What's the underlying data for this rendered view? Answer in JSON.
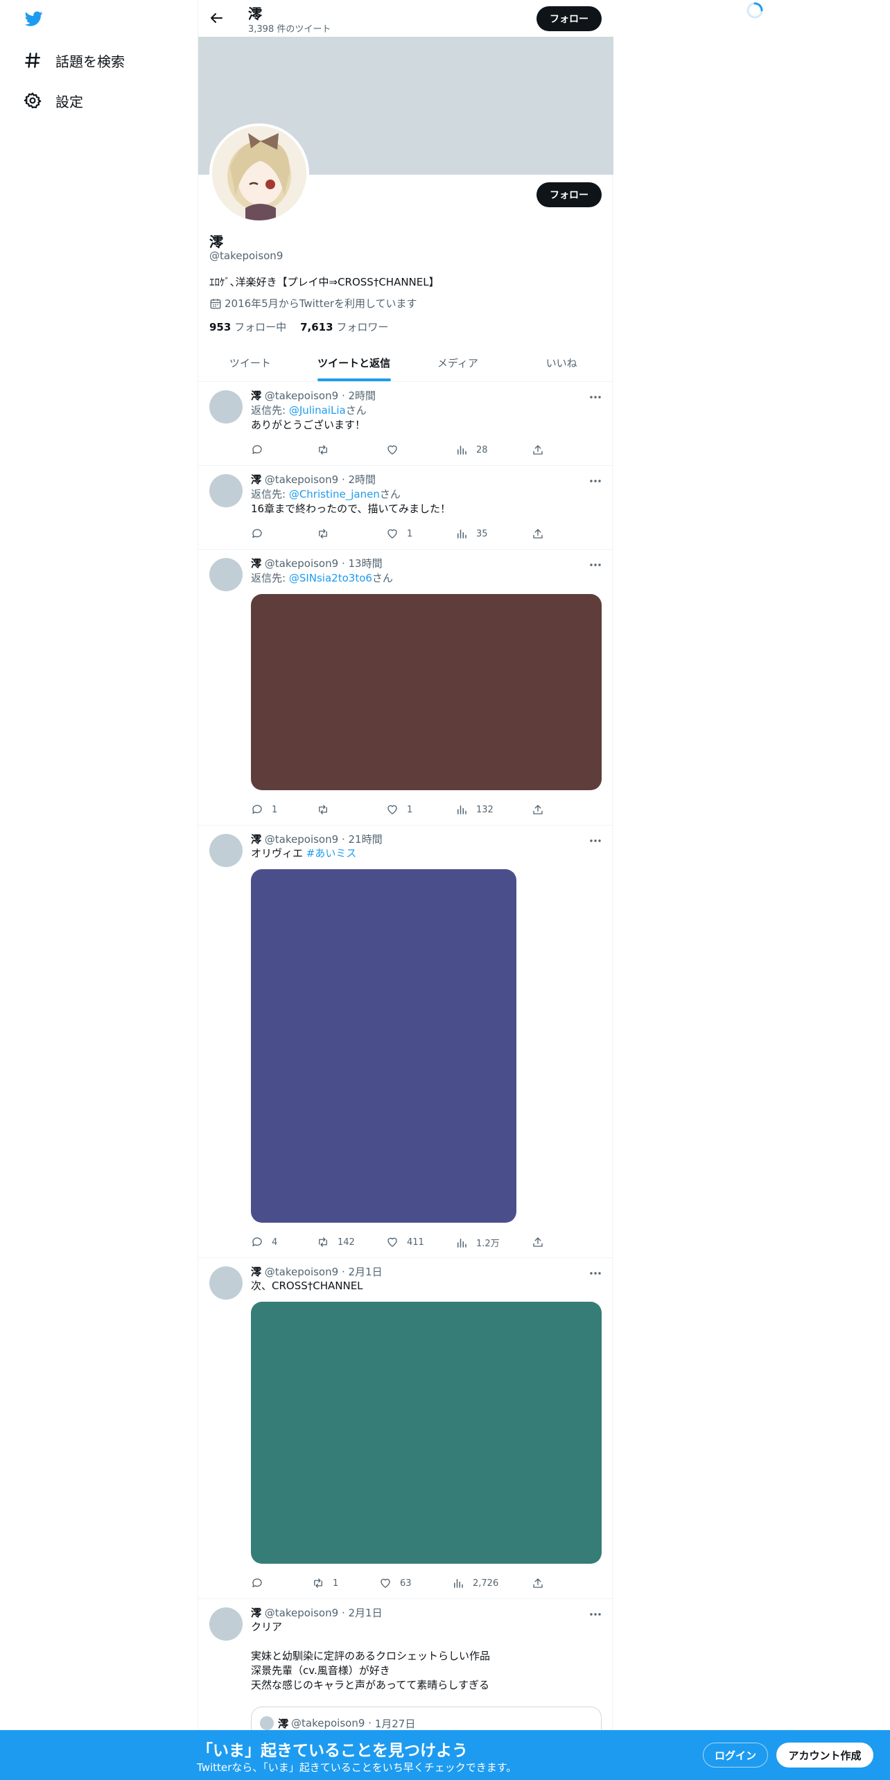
{
  "sidebar": {
    "logo": "twitter-bird-icon",
    "items": [
      {
        "icon": "hashtag-icon",
        "label": "話題を検索"
      },
      {
        "icon": "gear-icon",
        "label": "設定"
      }
    ]
  },
  "header": {
    "name": "澪",
    "tweet_count": "3,398 件のツイート",
    "follow_label": "フォロー"
  },
  "profile": {
    "name": "澪",
    "handle": "@takepoison9",
    "bio": "ｴﾛｹﾞ､洋楽好き【プレイ中⇒CROSS†CHANNEL】",
    "joined": "2016年5月からTwitterを利用しています",
    "following_count": "953",
    "following_label": "フォロー中",
    "followers_count": "7,613",
    "followers_label": "フォロワー",
    "follow_label": "フォロー"
  },
  "tabs": [
    {
      "label": "ツイート"
    },
    {
      "label": "ツイートと返信"
    },
    {
      "label": "メディア"
    },
    {
      "label": "いいね"
    }
  ],
  "tweets": [
    {
      "name": "澪",
      "handle": "@takepoison9",
      "time": "2時間",
      "reply_prefix": "返信先: ",
      "reply_to": "@JulinaiLia",
      "reply_suffix": "さん",
      "text": "ありがとうございます！",
      "replies": "",
      "retweets": "",
      "likes": "",
      "views": "28"
    },
    {
      "name": "澪",
      "handle": "@takepoison9",
      "time": "2時間",
      "reply_prefix": "返信先: ",
      "reply_to": "@Christine_janen",
      "reply_suffix": "さん",
      "text": "16章まで終わったので、描いてみました！",
      "replies": "",
      "retweets": "",
      "likes": "1",
      "views": "35"
    },
    {
      "name": "澪",
      "handle": "@takepoison9",
      "time": "13時間",
      "reply_prefix": "返信先: ",
      "reply_to": "@SINsia2to3to6",
      "reply_suffix": "さん",
      "media_color": "#5e3d3b",
      "replies": "1",
      "retweets": "",
      "likes": "1",
      "views": "132"
    },
    {
      "name": "澪",
      "handle": "@takepoison9",
      "time": "21時間",
      "text": "オリヴィエ ",
      "hashtag": "#あいミス",
      "media_color": "#4a4f8c",
      "replies": "4",
      "retweets": "142",
      "likes": "411",
      "views": "1.2万"
    },
    {
      "name": "澪",
      "handle": "@takepoison9",
      "time": "2月1日",
      "text": "次、CROSS†CHANNEL",
      "media_color": "#367d78",
      "replies": "",
      "retweets": "1",
      "likes": "63",
      "views": "2,726"
    },
    {
      "name": "澪",
      "handle": "@takepoison9",
      "time": "2月1日",
      "text": "クリア\n\n実妹と幼馴染に定評のあるクロシェットらしい作品\n深景先輩（cv.風音様）が好き\n天然な感じのキャラと声があってて素晴らしすぎる",
      "quote_name": "澪",
      "quote_handle": "@takepoison9",
      "quote_time": "1月27日"
    }
  ],
  "bottom_bar": {
    "title": "「いま」起きていることを見つけよう",
    "subtitle": "Twitterなら、「いま」起きていることをいち早くチェックできます。",
    "login_label": "ログイン",
    "signup_label": "アカウント作成"
  },
  "colors": {
    "accent": "#1d9bf0",
    "text": "#0f1419",
    "muted": "#536471",
    "banner": "#cfd9de"
  }
}
